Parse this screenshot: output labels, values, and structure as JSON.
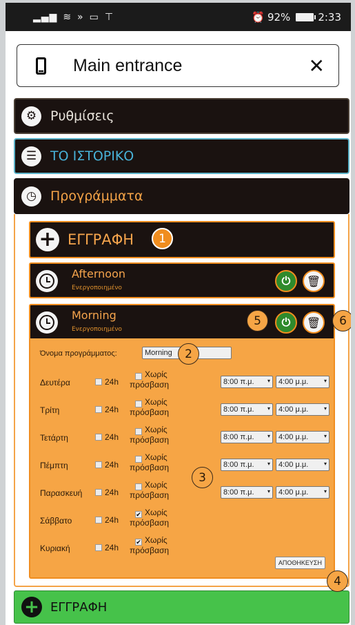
{
  "status_bar": {
    "left_icons": [
      "signal-icon",
      "wifi-icon",
      "nfc-icon",
      "car-icon",
      "antenna-icon"
    ],
    "alarm": "⏰",
    "battery_percent": "92%",
    "time": "2:33"
  },
  "header": {
    "title": "Main entrance",
    "close": "✕"
  },
  "sections": {
    "settings": "Ρυθμίσεις",
    "history": "ΤΟ ΙΣΤΟΡΙΚΟ",
    "programs": "Προγράμματα"
  },
  "programs": {
    "add_label": "ΕΓΓΡΑΦΗ",
    "list": [
      {
        "name": "Afternoon",
        "status": "Ενεργοποιημένο"
      },
      {
        "name": "Morning",
        "status": "Ενεργοποιημένο"
      }
    ]
  },
  "form": {
    "name_label": "Όνομα προγράμματος:",
    "name_value": "Morning",
    "label_24h": "24h",
    "no_access_line1": "Χωρίς",
    "no_access_line2": "πρόσβαση",
    "days": [
      {
        "day": "Δευτέρα",
        "no_access": false,
        "from": "8:00 π.μ.",
        "to": "4:00 μ.μ."
      },
      {
        "day": "Τρίτη",
        "no_access": false,
        "from": "8:00 π.μ.",
        "to": "4:00 μ.μ."
      },
      {
        "day": "Τετάρτη",
        "no_access": false,
        "from": "8:00 π.μ.",
        "to": "4:00 μ.μ."
      },
      {
        "day": "Πέμπτη",
        "no_access": false,
        "from": "8:00 π.μ.",
        "to": "4:00 μ.μ."
      },
      {
        "day": "Παρασκευή",
        "no_access": false,
        "from": "8:00 π.μ.",
        "to": "4:00 μ.μ."
      },
      {
        "day": "Σάββατο",
        "no_access": true
      },
      {
        "day": "Κυριακή",
        "no_access": true
      }
    ],
    "save_label": "ΑΠΟΘΗΚΕΥΣΗ"
  },
  "bottom_add_label": "ΕΓΓΡΑΦΗ",
  "annotations": [
    "1",
    "2",
    "3",
    "4",
    "5",
    "6"
  ],
  "colors": {
    "orange": "#f08d1f",
    "form_bg": "#f6a545",
    "dark": "#1a1210",
    "green": "#46c24a",
    "history_blue": "#48b2d8"
  }
}
